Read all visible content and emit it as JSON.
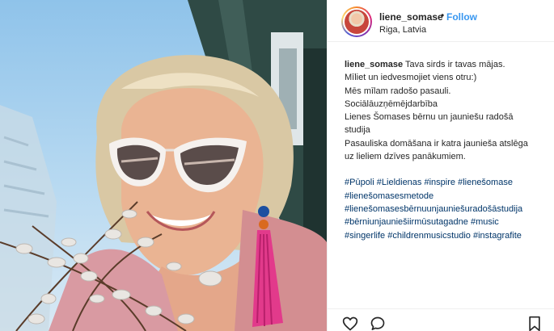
{
  "post": {
    "photo": {
      "description_icon": "photo"
    },
    "header": {
      "username": "liene_somase",
      "separator": "•",
      "follow_label": "Follow",
      "location": "Riga, Latvia"
    },
    "caption": {
      "username": "liene_somase",
      "text": "Tava sirds ir tavas mājas.\nMīliet un iedvesmojiet viens otru:)\nMēs mīlam radošo pasauli.\nSociālāuzņēmējdarbība\nLienes Šomases bērnu un jauniešu radošā\nstudija\nPasauliska domāšana ir katra jaunieša atslēga\nuz lieliem dzīves panākumiem.",
      "hashtags": [
        "#Pūpoli",
        "#Lieldienas",
        "#inspire",
        "#lienešomase",
        "#lienešomasesmetode",
        "#lienešomasesbērnuunjauniešuradošāstudija",
        "#bērniunjauniešiirmūsutagadne",
        "#music",
        "#singerlife",
        "#childrenmusicstudio",
        "#instagrafite"
      ]
    },
    "actions": {
      "like_icon": "heart-icon",
      "comment_icon": "comment-icon",
      "save_icon": "bookmark-icon"
    }
  }
}
